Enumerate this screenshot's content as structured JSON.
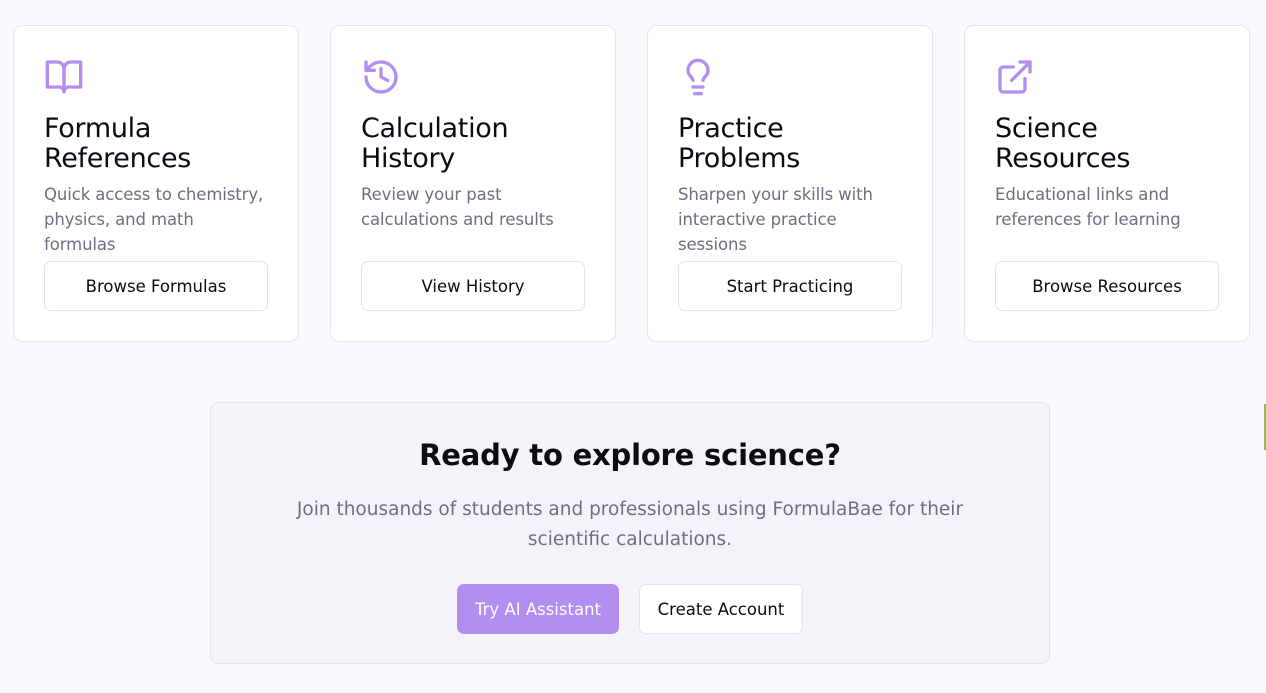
{
  "colors": {
    "accent": "#b18ef0",
    "background": "#f8f9fc",
    "muted_text": "#6b7080"
  },
  "cards": [
    {
      "icon": "book-open-icon",
      "title": "Formula References",
      "description": "Quick access to chemistry, physics, and math formulas",
      "button_label": "Browse Formulas"
    },
    {
      "icon": "history-icon",
      "title": "Calculation History",
      "description": "Review your past calculations and results",
      "button_label": "View History"
    },
    {
      "icon": "lightbulb-icon",
      "title": "Practice Problems",
      "description": "Sharpen your skills with interactive practice sessions",
      "button_label": "Start Practicing"
    },
    {
      "icon": "external-link-icon",
      "title": "Science Resources",
      "description": "Educational links and references for learning",
      "button_label": "Browse Resources"
    }
  ],
  "cta": {
    "title": "Ready to explore science?",
    "text": "Join thousands of students and professionals using FormulaBae for their scientific calculations.",
    "primary_button": "Try AI Assistant",
    "secondary_button": "Create Account"
  }
}
